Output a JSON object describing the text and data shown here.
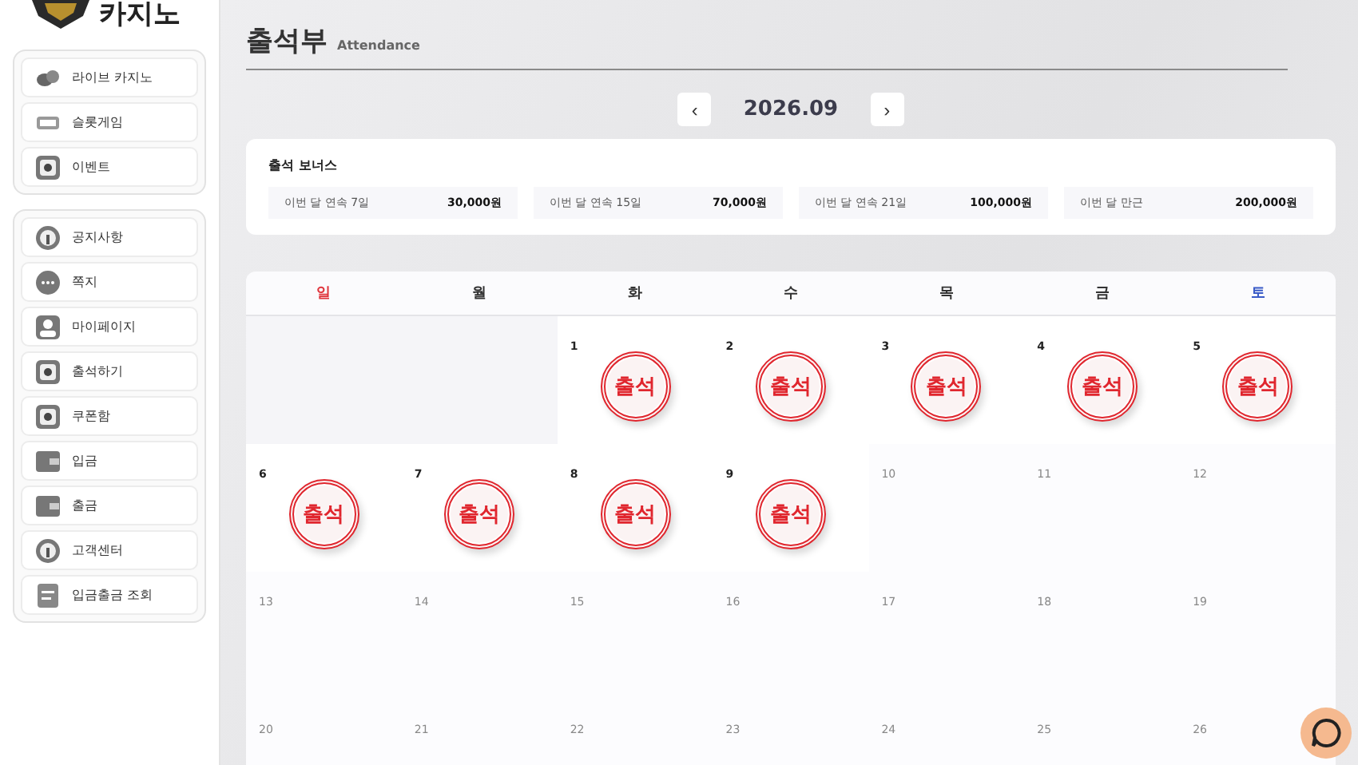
{
  "logo": {
    "text": "카지노"
  },
  "sidebar": {
    "groups": [
      {
        "items": [
          {
            "label": "라이브 카지노"
          },
          {
            "label": "슬롯게임"
          },
          {
            "label": "이벤트"
          }
        ]
      },
      {
        "items": [
          {
            "label": "공지사항"
          },
          {
            "label": "쪽지"
          },
          {
            "label": "마이페이지"
          },
          {
            "label": "출석하기"
          },
          {
            "label": "쿠폰함"
          },
          {
            "label": "입금"
          },
          {
            "label": "출금"
          },
          {
            "label": "고객센터"
          },
          {
            "label": "입금출금 조회"
          }
        ]
      }
    ]
  },
  "page": {
    "title": "출석부",
    "subtitle": "Attendance"
  },
  "month_nav": {
    "prev": "‹",
    "month": "2026.09",
    "next": "›"
  },
  "bonus": {
    "title": "출석 보너스",
    "items": [
      {
        "label": "이번 달 연속 7일",
        "amount": "30,000원"
      },
      {
        "label": "이번 달 연속 15일",
        "amount": "70,000원"
      },
      {
        "label": "이번 달 연속 21일",
        "amount": "100,000원"
      },
      {
        "label": "이번 달 만근",
        "amount": "200,000원"
      }
    ]
  },
  "calendar": {
    "weekdays": [
      {
        "label": "일",
        "color": "#e0343c"
      },
      {
        "label": "월",
        "color": "#333333"
      },
      {
        "label": "화",
        "color": "#333333"
      },
      {
        "label": "수",
        "color": "#333333"
      },
      {
        "label": "목",
        "color": "#333333"
      },
      {
        "label": "금",
        "color": "#333333"
      },
      {
        "label": "토",
        "color": "#3a5bc7"
      }
    ],
    "weeks": [
      [
        {
          "empty": true
        },
        {
          "empty": true
        },
        {
          "day": "1",
          "stamp": "출석"
        },
        {
          "day": "2",
          "stamp": "출석"
        },
        {
          "day": "3",
          "stamp": "출석"
        },
        {
          "day": "4",
          "stamp": "출석"
        },
        {
          "day": "5",
          "stamp": "출석"
        }
      ],
      [
        {
          "day": "6",
          "stamp": "출석"
        },
        {
          "day": "7",
          "stamp": "출석"
        },
        {
          "day": "8",
          "stamp": "출석"
        },
        {
          "day": "9",
          "stamp": "출석"
        },
        {
          "day": "10"
        },
        {
          "day": "11"
        },
        {
          "day": "12"
        }
      ],
      [
        {
          "day": "13"
        },
        {
          "day": "14"
        },
        {
          "day": "15"
        },
        {
          "day": "16"
        },
        {
          "day": "17"
        },
        {
          "day": "18"
        },
        {
          "day": "19"
        }
      ],
      [
        {
          "day": "20"
        },
        {
          "day": "21"
        },
        {
          "day": "22"
        },
        {
          "day": "23"
        },
        {
          "day": "24"
        },
        {
          "day": "25"
        },
        {
          "day": "26"
        }
      ]
    ]
  }
}
